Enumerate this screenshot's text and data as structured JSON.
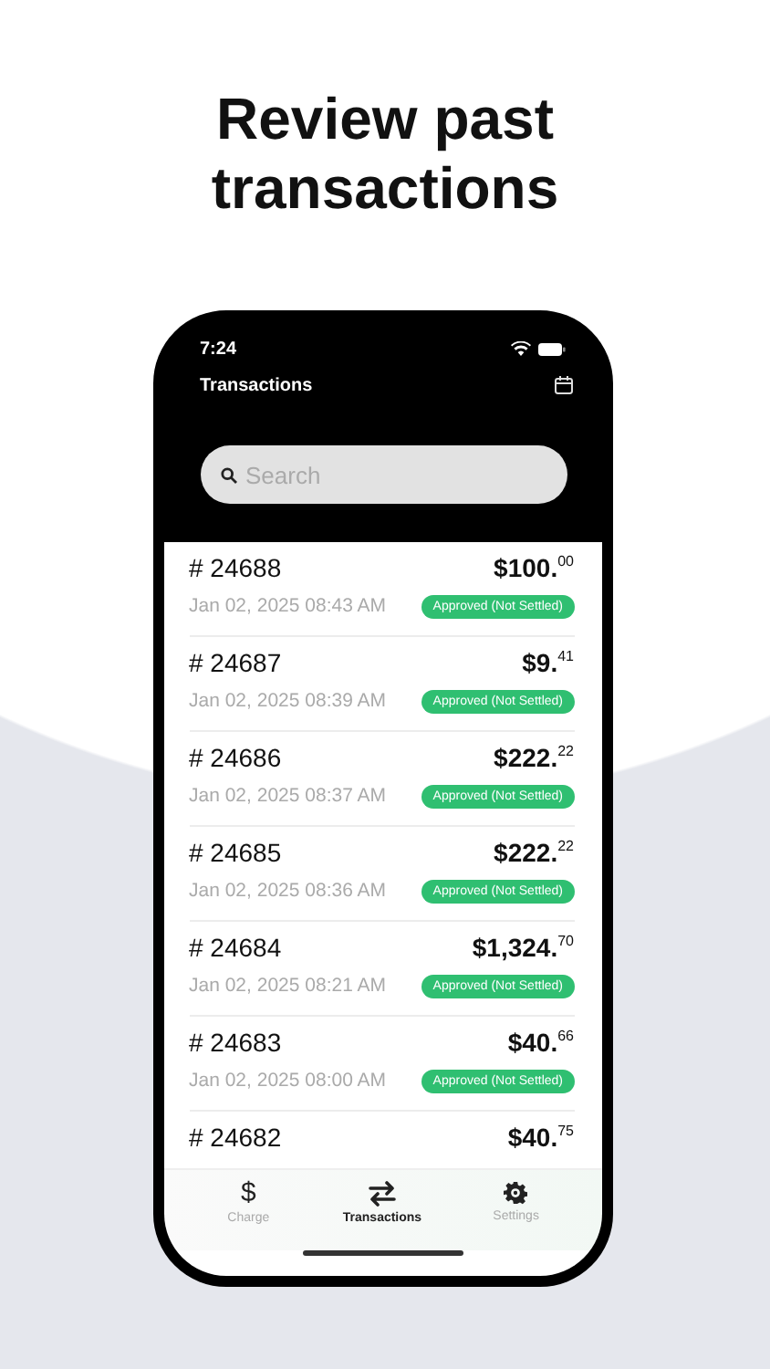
{
  "headline": "Review past transactions",
  "status_bar": {
    "time": "7:24"
  },
  "nav": {
    "title": "Transactions"
  },
  "search": {
    "placeholder": "Search"
  },
  "transactions": [
    {
      "number": "# 24688",
      "amount": "$100.$^{00}$",
      "date": "Jan 02, 2025 08:43 AM",
      "status": "Approved (Not Settled)"
    },
    {
      "number": "# 24687",
      "amount": "$9.$^{41}$",
      "date": "Jan 02, 2025 08:39 AM",
      "status": "Approved (Not Settled)"
    },
    {
      "number": "# 24686",
      "amount": "$222.$^{22}$",
      "date": "Jan 02, 2025 08:37 AM",
      "status": "Approved (Not Settled)"
    },
    {
      "number": "# 24685",
      "amount": "$222.$^{22}$",
      "date": "Jan 02, 2025 08:36 AM",
      "status": "Approved (Not Settled)"
    },
    {
      "number": "# 24684",
      "amount": "$1,324.$^{70}$",
      "date": "Jan 02, 2025 08:21 AM",
      "status": "Approved (Not Settled)"
    },
    {
      "number": "# 24683",
      "amount": "$40.$^{66}$",
      "date": "Jan 02, 2025 08:00 AM",
      "status": "Approved (Not Settled)"
    },
    {
      "number": "# 24682",
      "amount": "$40.$^{75}$"
    }
  ],
  "tabs": [
    {
      "kind": "glyph",
      "glyph": "$",
      "label": "Charge",
      "selected": false
    },
    {
      "kind": "swap",
      "label": "Transactions",
      "selected": true
    },
    {
      "kind": "gear",
      "label": "Settings",
      "selected": false
    }
  ]
}
